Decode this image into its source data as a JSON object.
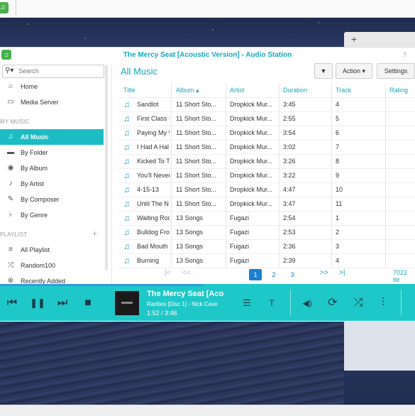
{
  "window": {
    "title": "The Mercy Seat [Acoustic Version] - Audio Station",
    "help": "?"
  },
  "search": {
    "placeholder": "Search"
  },
  "sidebar": {
    "items": [
      {
        "label": "Home",
        "icon": "home-icon",
        "glyph": "⌂"
      },
      {
        "label": "Media Server",
        "icon": "media-server-icon",
        "glyph": "▭"
      }
    ],
    "my_music_header": "MY MUSIC",
    "music": [
      {
        "label": "All Music",
        "icon": "music-note-icon",
        "glyph": "♫",
        "active": true
      },
      {
        "label": "By Folder",
        "icon": "folder-icon",
        "glyph": "▬"
      },
      {
        "label": "By Album",
        "icon": "album-icon",
        "glyph": "◉"
      },
      {
        "label": "By Artist",
        "icon": "artist-icon",
        "glyph": "♪"
      },
      {
        "label": "By Composer",
        "icon": "composer-icon",
        "glyph": "✎"
      },
      {
        "label": "By Genre",
        "icon": "genre-icon",
        "glyph": "♭"
      }
    ],
    "playlist_header": "PLAYLIST",
    "add_playlist": "+",
    "playlists": [
      {
        "label": "All Playlist",
        "icon": "playlist-icon",
        "glyph": "≡"
      },
      {
        "label": "Random100",
        "icon": "shuffle-icon",
        "glyph": "⤮"
      },
      {
        "label": "Recently Added",
        "icon": "recently-added-icon",
        "glyph": "⊕"
      }
    ]
  },
  "main": {
    "heading": "All Music",
    "filter_button": "▼",
    "action_button": "Action ▾",
    "settings_button": "Settings",
    "columns": [
      "Title",
      "Album ▴",
      "Artist",
      "Duration",
      "Track",
      "Rating"
    ],
    "rows": [
      [
        "Sandlot",
        "11 Short Sto...",
        "Dropkick Mur...",
        "3:45",
        "4"
      ],
      [
        "First Class I",
        "11 Short Sto...",
        "Dropkick Mur...",
        "2:55",
        "5"
      ],
      [
        "Paying My \\",
        "11 Short Sto...",
        "Dropkick Mur...",
        "3:54",
        "6"
      ],
      [
        "I Had A Hal",
        "11 Short Sto...",
        "Dropkick Mur...",
        "3:02",
        "7"
      ],
      [
        "Kicked To T",
        "11 Short Sto...",
        "Dropkick Mur...",
        "3:26",
        "8"
      ],
      [
        "You'll Never",
        "11 Short Sto...",
        "Dropkick Mur...",
        "3:22",
        "9"
      ],
      [
        "4-15-13",
        "11 Short Sto...",
        "Dropkick Mur...",
        "4:47",
        "10"
      ],
      [
        "Until The N",
        "11 Short Sto...",
        "Dropkick Mur...",
        "3:47",
        "11"
      ],
      [
        "Waiting Roo",
        "13 Songs",
        "Fugazi",
        "2:54",
        "1"
      ],
      [
        "Bulldog Fro",
        "13 Songs",
        "Fugazi",
        "2:53",
        "2"
      ],
      [
        "Bad Mouth",
        "13 Songs",
        "Fugazi",
        "2:36",
        "3"
      ],
      [
        "Burning",
        "13 Songs",
        "Fugazi",
        "2:39",
        "4"
      ]
    ],
    "pager": {
      "first": "|<",
      "prev": "<<",
      "pages": [
        "1",
        "2",
        "3"
      ],
      "next": ">>",
      "last": ">|",
      "total": "7022 ite"
    }
  },
  "player": {
    "title": "The Mercy Seat [Aco",
    "subtitle": "Rarities [Disc 1] - Nick Cave",
    "time": "1:52 / 3:46",
    "progress": 0.49,
    "controls": {
      "prev": "⏮",
      "pause": "❚❚",
      "next": "⏭",
      "stop": "■",
      "queue": "☰",
      "lyrics": "T",
      "volume": "◀)",
      "repeat": "⟳",
      "shuffle": "⤮",
      "equalizer": "⫶"
    }
  },
  "colors": {
    "accent": "#1aa6b7",
    "player": "#1fc8c8",
    "active": "#1bbcc4"
  }
}
